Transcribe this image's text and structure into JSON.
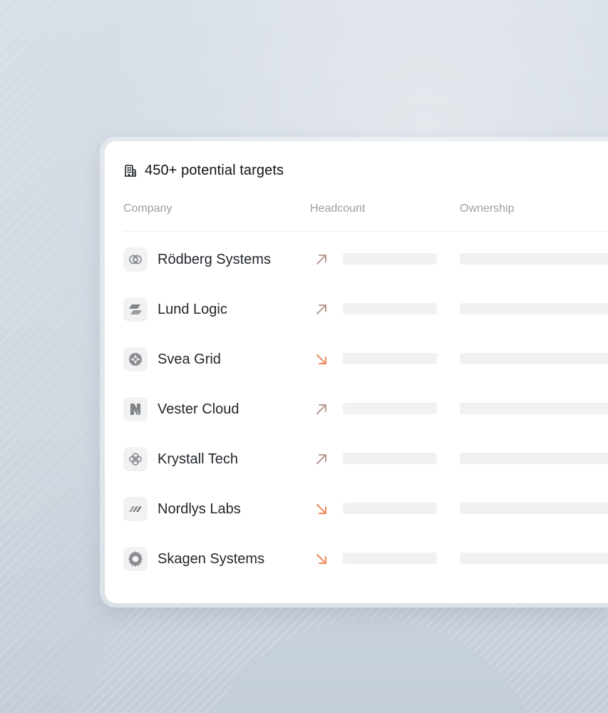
{
  "title": {
    "icon": "building-icon",
    "text": "450+ potential targets"
  },
  "table": {
    "columns": [
      {
        "key": "company",
        "label": "Company"
      },
      {
        "key": "headcount",
        "label": "Headcount"
      },
      {
        "key": "ownership",
        "label": "Ownership"
      }
    ],
    "rows": [
      {
        "company": "Rödberg Systems",
        "logo_icon": "interlocked-rings-icon",
        "headcount_trend": "up",
        "trend_icon": "arrow-up-right-icon"
      },
      {
        "company": "Lund Logic",
        "logo_icon": "slanted-bars-icon",
        "headcount_trend": "up",
        "trend_icon": "arrow-up-right-icon"
      },
      {
        "company": "Svea Grid",
        "logo_icon": "compass-star-icon",
        "headcount_trend": "down",
        "trend_icon": "arrow-down-right-icon"
      },
      {
        "company": "Vester Cloud",
        "logo_icon": "n-mark-icon",
        "headcount_trend": "up",
        "trend_icon": "arrow-up-right-icon"
      },
      {
        "company": "Krystall Tech",
        "logo_icon": "flower-icon",
        "headcount_trend": "up",
        "trend_icon": "arrow-up-right-icon"
      },
      {
        "company": "Nordlys Labs",
        "logo_icon": "diagonal-stripes-icon",
        "headcount_trend": "down",
        "trend_icon": "arrow-down-right-icon"
      },
      {
        "company": "Skagen Systems",
        "logo_icon": "gear-ring-icon",
        "headcount_trend": "down",
        "trend_icon": "arrow-down-right-icon"
      }
    ]
  },
  "colors": {
    "trend_up": "#b89c93",
    "trend_down": "#f08a5d",
    "skeleton": "#f3f0f0",
    "muted_text": "#9aa0a6"
  }
}
